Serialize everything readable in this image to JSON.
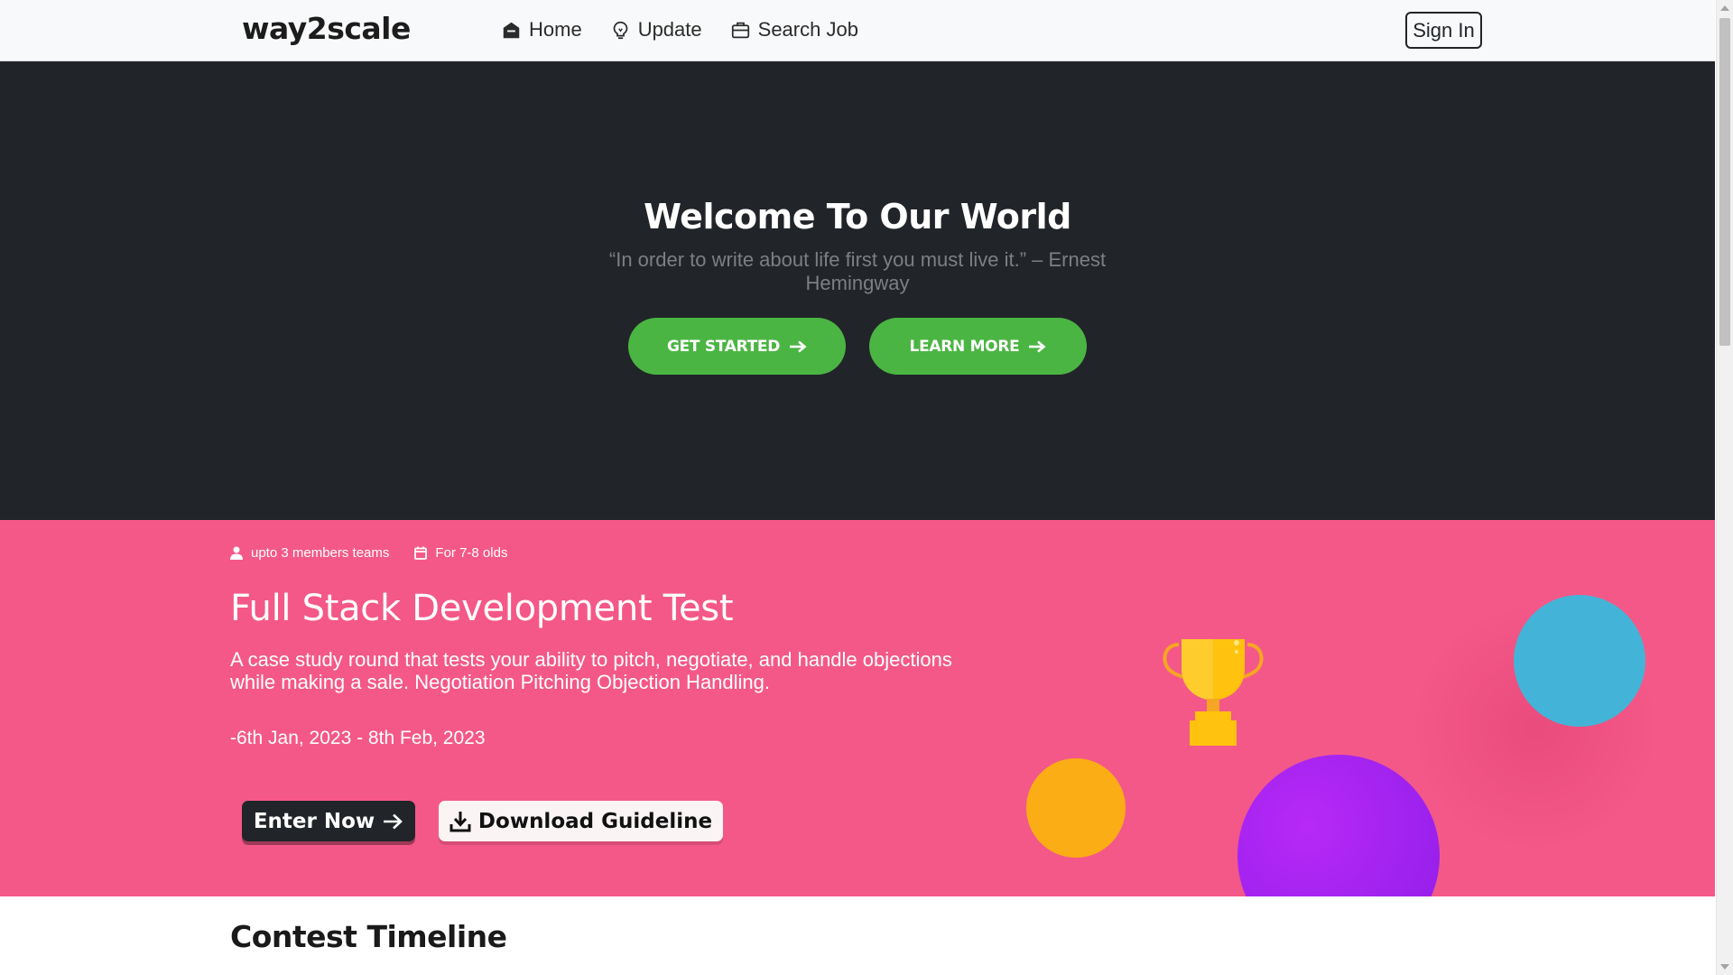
{
  "navbar": {
    "brand": "way2scale",
    "links": [
      {
        "label": "Home",
        "icon": "home-icon"
      },
      {
        "label": "Update",
        "icon": "bulb-icon"
      },
      {
        "label": "Search Job",
        "icon": "briefcase-icon"
      }
    ],
    "sign_in": "Sign In"
  },
  "hero": {
    "title": "Welcome To Our World",
    "quote": "“In order to write about life first you must live it.” – Ernest Hemingway",
    "get_started": "GET STARTED",
    "learn_more": "LEARN MORE"
  },
  "contest": {
    "team_size": "upto 3 members teams",
    "age_group": "For 7-8 olds",
    "title": "Full Stack Development Test",
    "description": "A case study round that tests your ability to pitch, negotiate, and handle objections while making a sale. Negotiation Pitching Objection Handling.",
    "dates": "-6th Jan, 2023 - 8th Feb, 2023",
    "enter_now": "Enter Now",
    "download_guideline": "Download Guideline"
  },
  "timeline": {
    "title": "Contest Timeline"
  },
  "colors": {
    "hero_bg": "#212529",
    "accent_green": "#4bb543",
    "contest_pink": "#f45888",
    "circle_blue": "#43b4d8",
    "circle_orange": "#fbad16",
    "circle_purple": "#a623f0",
    "trophy_gold": "#ffc20e"
  }
}
